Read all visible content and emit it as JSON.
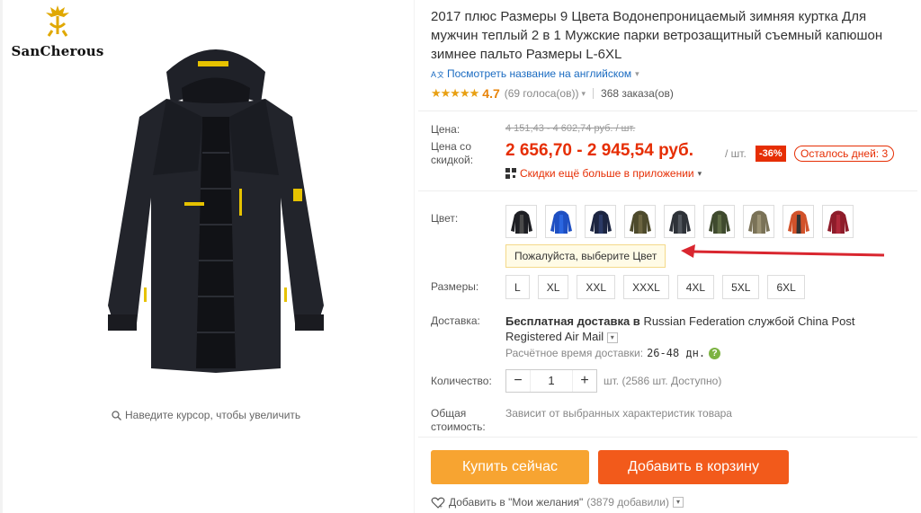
{
  "brand": {
    "name": "SanCherous"
  },
  "gallery": {
    "zoom_hint": "Наведите курсор, чтобы увеличить"
  },
  "product": {
    "title": "2017 плюс Размеры 9 Цвета Водонепроницаемый зимняя куртка Для мужчин теплый 2 в 1 Мужские парки ветрозащитный съемный капюшон зимнее пальто Размеры L-6XL",
    "translate_link": "Посмотреть название на английском",
    "rating_value": "4.7",
    "votes": "(69 голоса(ов))",
    "orders": "368 заказа(ов)"
  },
  "price": {
    "label": "Цена:",
    "old_price": "4 151,43 - 4 602,74 руб. / шт.",
    "discount_label": "Цена со скидкой:",
    "new_price": "2 656,70 - 2 945,54 руб.",
    "per_unit": "/ шт.",
    "discount_badge": "-36%",
    "days_left": "Осталось дней: 3",
    "app_promo": "Скидки ещё больше в приложении"
  },
  "color": {
    "label": "Цвет:",
    "tip": "Пожалуйста, выберите Цвет",
    "swatches": [
      {
        "name": "black",
        "fill": "#1e1f24",
        "accent": "#4a4a4a"
      },
      {
        "name": "blue",
        "fill": "#1e4fc2",
        "accent": "#2b66e0"
      },
      {
        "name": "navy",
        "fill": "#1c2541",
        "accent": "#2b3a66"
      },
      {
        "name": "army-green",
        "fill": "#4d4a2c",
        "accent": "#6b6440"
      },
      {
        "name": "dark-gray",
        "fill": "#2e3238",
        "accent": "#50555c"
      },
      {
        "name": "green",
        "fill": "#3f4a2e",
        "accent": "#5d6b44"
      },
      {
        "name": "khaki",
        "fill": "#7a7257",
        "accent": "#9b9273"
      },
      {
        "name": "orange",
        "fill": "#d2522a",
        "accent": "#333333"
      },
      {
        "name": "red",
        "fill": "#8e1c2a",
        "accent": "#b0293a"
      }
    ]
  },
  "size": {
    "label": "Размеры:",
    "options": [
      "L",
      "XL",
      "XXL",
      "XXXL",
      "4XL",
      "5XL",
      "6XL"
    ]
  },
  "shipping": {
    "label": "Доставка:",
    "free_text": "Бесплатная доставка в",
    "destination": "Russian Federation",
    "via": "службой",
    "carrier": "China Post Registered Air Mail",
    "time_label": "Расчётное время доставки:",
    "time_value": "26-48 дн.",
    "help": "?"
  },
  "quantity": {
    "label": "Количество:",
    "minus": "−",
    "value": "1",
    "plus": "+",
    "available": "шт. (2586 шт. Доступно)"
  },
  "total": {
    "label": "Общая стоимость:",
    "note": "Зависит от выбранных характеристик товара"
  },
  "actions": {
    "buy_now": "Купить сейчас",
    "add_to_cart": "Добавить в корзину",
    "wishlist": "Добавить в \"Мои желания\"",
    "wishlist_count": "(3879 добавили)"
  },
  "colors": {
    "accent": "#e62e04",
    "buy": "#f7a431",
    "cart": "#f25a1b",
    "link": "#1a6bc1",
    "star": "#e8a013"
  }
}
